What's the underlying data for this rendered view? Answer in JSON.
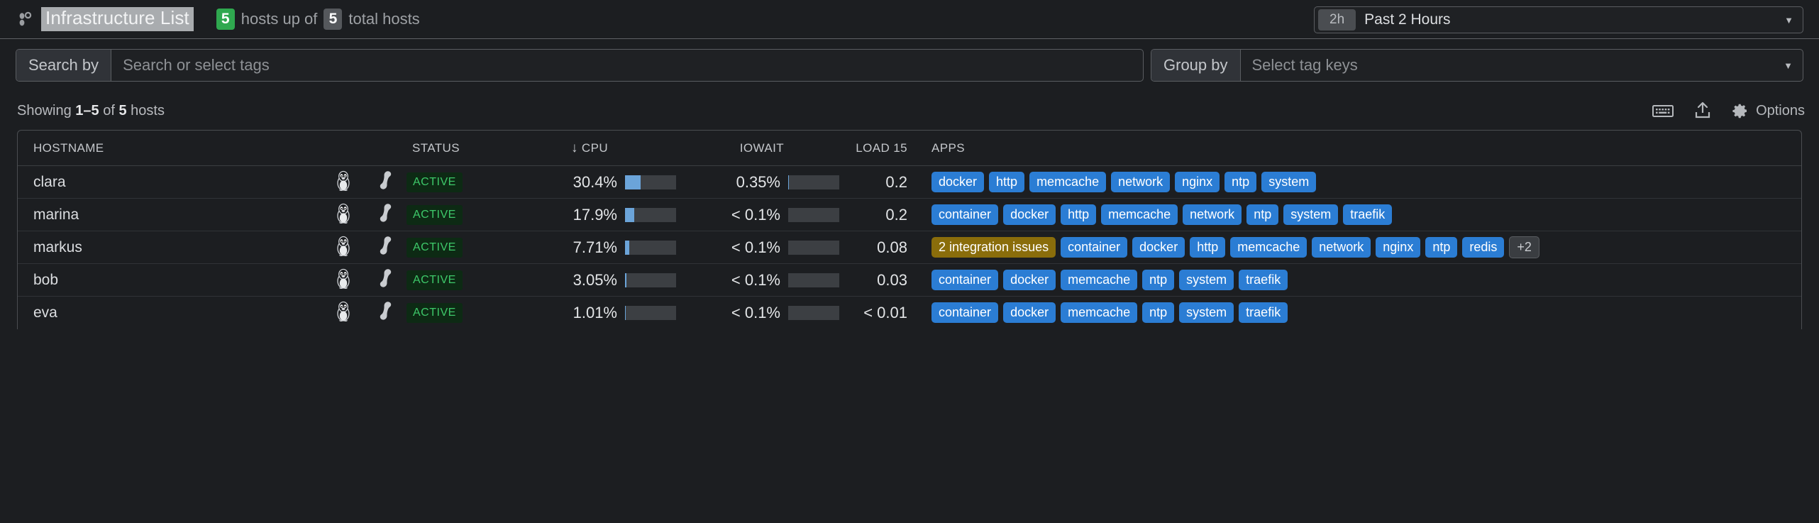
{
  "header": {
    "logo_icon": "infrastructure-hosts-icon",
    "title": "Infrastructure List",
    "hosts_up": "5",
    "hosts_up_label": "hosts up of",
    "hosts_total": "5",
    "hosts_total_label": "total hosts",
    "timepicker": {
      "badge": "2h",
      "label": "Past 2 Hours",
      "caret_icon": "chevron-down-icon"
    }
  },
  "filters": {
    "search_label": "Search by",
    "search_placeholder": "Search or select tags",
    "search_value": "",
    "groupby_label": "Group by",
    "groupby_placeholder": "Select tag keys",
    "groupby_value": "",
    "caret_icon": "chevron-down-icon"
  },
  "toolbar": {
    "showing_prefix": "Showing ",
    "showing_range": "1–5",
    "showing_of": " of ",
    "showing_total": "5",
    "showing_suffix": " hosts",
    "keyboard_icon": "keyboard-icon",
    "export_icon": "export-upload-icon",
    "gear_icon": "gear-icon",
    "options_label": "Options"
  },
  "table": {
    "columns": [
      {
        "key": "hostname",
        "label": "HOSTNAME"
      },
      {
        "key": "os",
        "label": ""
      },
      {
        "key": "chef",
        "label": ""
      },
      {
        "key": "status",
        "label": "STATUS"
      },
      {
        "key": "cpu",
        "label": "CPU",
        "sort_icon": "sort-desc-arrow-icon",
        "sorted": true
      },
      {
        "key": "iowait",
        "label": "IOWAIT"
      },
      {
        "key": "load15",
        "label": "LOAD 15"
      },
      {
        "key": "apps",
        "label": "APPS"
      }
    ],
    "rows": [
      {
        "hostname": "clara",
        "os_icon": "linux-tux-icon",
        "config_icon": "chef-bone-icon",
        "status": "ACTIVE",
        "cpu": "30.4%",
        "cpu_pct": 30.4,
        "iowait": "0.35%",
        "iowait_pct": 0.35,
        "load15": "0.2",
        "apps": [
          {
            "label": "docker",
            "kind": "app"
          },
          {
            "label": "http",
            "kind": "app"
          },
          {
            "label": "memcache",
            "kind": "app"
          },
          {
            "label": "network",
            "kind": "app"
          },
          {
            "label": "nginx",
            "kind": "app"
          },
          {
            "label": "ntp",
            "kind": "app"
          },
          {
            "label": "system",
            "kind": "app"
          }
        ]
      },
      {
        "hostname": "marina",
        "os_icon": "linux-tux-icon",
        "config_icon": "chef-bone-icon",
        "status": "ACTIVE",
        "cpu": "17.9%",
        "cpu_pct": 17.9,
        "iowait": "< 0.1%",
        "iowait_pct": 0.05,
        "load15": "0.2",
        "apps": [
          {
            "label": "container",
            "kind": "app"
          },
          {
            "label": "docker",
            "kind": "app"
          },
          {
            "label": "http",
            "kind": "app"
          },
          {
            "label": "memcache",
            "kind": "app"
          },
          {
            "label": "network",
            "kind": "app"
          },
          {
            "label": "ntp",
            "kind": "app"
          },
          {
            "label": "system",
            "kind": "app"
          },
          {
            "label": "traefik",
            "kind": "app"
          }
        ]
      },
      {
        "hostname": "markus",
        "os_icon": "linux-tux-icon",
        "config_icon": "chef-bone-icon",
        "status": "ACTIVE",
        "cpu": "7.71%",
        "cpu_pct": 7.71,
        "iowait": "< 0.1%",
        "iowait_pct": 0.05,
        "load15": "0.08",
        "apps": [
          {
            "label": "2 integration issues",
            "kind": "warn"
          },
          {
            "label": "container",
            "kind": "app"
          },
          {
            "label": "docker",
            "kind": "app"
          },
          {
            "label": "http",
            "kind": "app"
          },
          {
            "label": "memcache",
            "kind": "app"
          },
          {
            "label": "network",
            "kind": "app"
          },
          {
            "label": "nginx",
            "kind": "app"
          },
          {
            "label": "ntp",
            "kind": "app"
          },
          {
            "label": "redis",
            "kind": "app"
          },
          {
            "label": "+2",
            "kind": "more"
          }
        ]
      },
      {
        "hostname": "bob",
        "os_icon": "linux-tux-icon",
        "config_icon": "chef-bone-icon",
        "status": "ACTIVE",
        "cpu": "3.05%",
        "cpu_pct": 3.05,
        "iowait": "< 0.1%",
        "iowait_pct": 0.05,
        "load15": "0.03",
        "apps": [
          {
            "label": "container",
            "kind": "app"
          },
          {
            "label": "docker",
            "kind": "app"
          },
          {
            "label": "memcache",
            "kind": "app"
          },
          {
            "label": "ntp",
            "kind": "app"
          },
          {
            "label": "system",
            "kind": "app"
          },
          {
            "label": "traefik",
            "kind": "app"
          }
        ]
      },
      {
        "hostname": "eva",
        "os_icon": "linux-tux-icon",
        "config_icon": "chef-bone-icon",
        "status": "ACTIVE",
        "cpu": "1.01%",
        "cpu_pct": 1.01,
        "iowait": "< 0.1%",
        "iowait_pct": 0.05,
        "load15": "< 0.01",
        "apps": [
          {
            "label": "container",
            "kind": "app"
          },
          {
            "label": "docker",
            "kind": "app"
          },
          {
            "label": "memcache",
            "kind": "app"
          },
          {
            "label": "ntp",
            "kind": "app"
          },
          {
            "label": "system",
            "kind": "app"
          },
          {
            "label": "traefik",
            "kind": "app"
          }
        ]
      }
    ]
  },
  "colors": {
    "background": "#1c1e21",
    "accent_blue": "#2b7dd4",
    "bar_blue": "#6ba4d9",
    "status_green": "#3ec96a",
    "warn_gold": "#8a6d0b",
    "pill_green": "#2fa84f"
  }
}
